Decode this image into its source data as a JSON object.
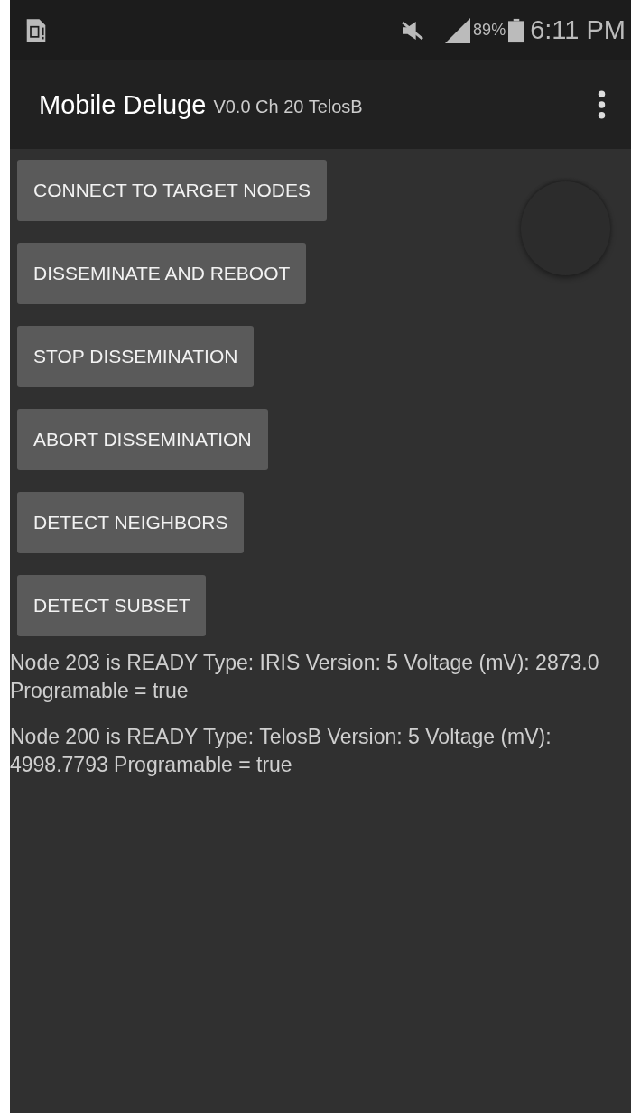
{
  "status_bar": {
    "battery": "89%",
    "time": "6:11 PM"
  },
  "action_bar": {
    "title": "Mobile Deluge",
    "subtitle": "V0.0 Ch 20 TelosB"
  },
  "buttons": [
    "CONNECT TO TARGET NODES",
    "DISSEMINATE AND REBOOT",
    "STOP DISSEMINATION",
    "ABORT DISSEMINATION",
    "DETECT NEIGHBORS",
    "DETECT SUBSET"
  ],
  "messages": [
    "Node 203 is READY Type: IRIS Version: 5 Voltage (mV): 2873.0 Programable = true",
    "Node 200 is READY Type: TelosB Version: 5 Voltage (mV): 4998.7793 Programable = true"
  ]
}
